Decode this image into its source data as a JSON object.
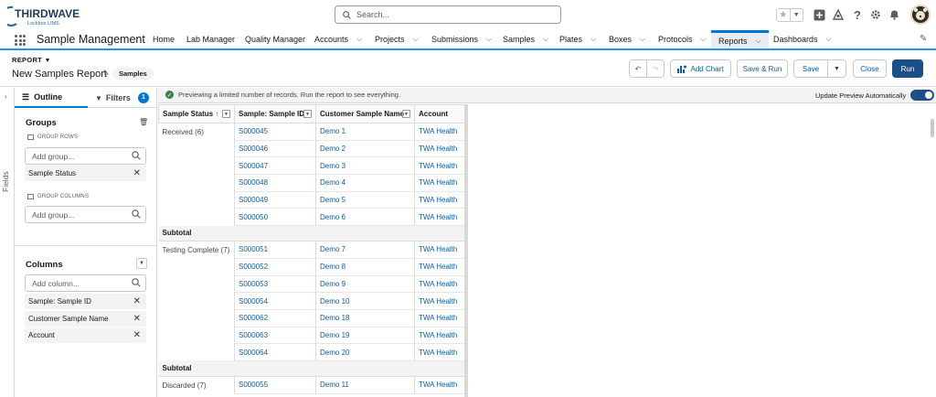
{
  "logo": {
    "brand": "THIRDWAVE",
    "sub": "Lockbox LIMS"
  },
  "search": {
    "placeholder": "Search..."
  },
  "app": {
    "name": "Sample Management"
  },
  "nav": [
    {
      "label": "Home",
      "chevron": false
    },
    {
      "label": "Lab Manager",
      "chevron": false
    },
    {
      "label": "Quality Manager",
      "chevron": false
    },
    {
      "label": "Accounts",
      "chevron": true
    },
    {
      "label": "Projects",
      "chevron": true
    },
    {
      "label": "Submissions",
      "chevron": true
    },
    {
      "label": "Samples",
      "chevron": true
    },
    {
      "label": "Plates",
      "chevron": true
    },
    {
      "label": "Boxes",
      "chevron": true
    },
    {
      "label": "Protocols",
      "chevron": true
    },
    {
      "label": "Reports",
      "chevron": true,
      "active": true
    },
    {
      "label": "Dashboards",
      "chevron": true
    }
  ],
  "header": {
    "breadcrumb": "REPORT",
    "title": "New Samples Report",
    "object_badge": "Samples",
    "buttons": {
      "add_chart": "Add Chart",
      "save_run": "Save & Run",
      "save": "Save",
      "close": "Close",
      "run": "Run"
    }
  },
  "fields_rail": {
    "label": "Fields"
  },
  "panel": {
    "tab_outline": "Outline",
    "tab_filters": "Filters",
    "filter_count": "1",
    "groups_title": "Groups",
    "group_rows_label": "GROUP ROWS",
    "group_rows_placeholder": "Add group...",
    "group_rows_items": [
      "Sample Status"
    ],
    "group_columns_label": "GROUP COLUMNS",
    "group_columns_placeholder": "Add group...",
    "columns_title": "Columns",
    "columns_placeholder": "Add column...",
    "columns_items": [
      "Sample: Sample ID",
      "Customer Sample Name",
      "Account"
    ]
  },
  "preview": {
    "message": "Previewing a limited number of records. Run the report to see everything.",
    "update_label": "Update Preview Automatically",
    "update_on": true
  },
  "table": {
    "headers": [
      "Sample Status",
      "Sample: Sample ID",
      "Customer Sample Name",
      "Account"
    ],
    "sort_indicator": "↑",
    "subtotal_label": "Subtotal",
    "groups": [
      {
        "label": "Received (6)",
        "rows": [
          [
            "S000045",
            "Demo 1",
            "TWA Health"
          ],
          [
            "S000046",
            "Demo 2",
            "TWA Health"
          ],
          [
            "S000047",
            "Demo 3",
            "TWA Health"
          ],
          [
            "S000048",
            "Demo 4",
            "TWA Health"
          ],
          [
            "S000049",
            "Demo 5",
            "TWA Health"
          ],
          [
            "S000050",
            "Demo 6",
            "TWA Health"
          ]
        ]
      },
      {
        "label": "Testing Complete (7)",
        "rows": [
          [
            "S000051",
            "Demo 7",
            "TWA Health"
          ],
          [
            "S000052",
            "Demo 8",
            "TWA Health"
          ],
          [
            "S000053",
            "Demo 9",
            "TWA Health"
          ],
          [
            "S000054",
            "Demo 10",
            "TWA Health"
          ],
          [
            "S000062",
            "Demo 18",
            "TWA Health"
          ],
          [
            "S000063",
            "Demo 19",
            "TWA Health"
          ],
          [
            "S000064",
            "Demo 20",
            "TWA Health"
          ]
        ]
      },
      {
        "label": "Discarded (7)",
        "rows": [
          [
            "S000055",
            "Demo 11",
            "TWA Health"
          ]
        ]
      }
    ]
  },
  "colors": {
    "accent": "#0176d3",
    "run_button": "#1b4f8a",
    "link": "#0b5cab",
    "success": "#2e844a"
  }
}
